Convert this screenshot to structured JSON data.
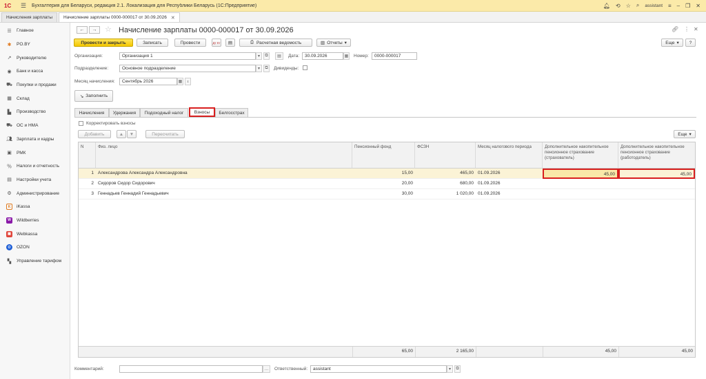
{
  "app": {
    "title": "Бухгалтерия для Беларуси, редакция 2.1. Локализация для Республики Беларусь   (1С:Предприятие)",
    "logo": "1С",
    "user": "assistant",
    "icons": [
      "bell-icon",
      "history-icon",
      "star-icon",
      "search-icon",
      "settings-icon",
      "minimize-icon",
      "restore-icon",
      "close-icon"
    ]
  },
  "tabs": [
    {
      "label": "Начисления зарплаты",
      "closable": false
    },
    {
      "label": "Начисление зарплаты 0000-000017 от 30.09.2026",
      "closable": true
    }
  ],
  "sidebar": {
    "items": [
      {
        "label": "Главное",
        "icon": "menu-icon"
      },
      {
        "label": "PO.BY",
        "icon": "po-icon"
      },
      {
        "label": "Руководителю",
        "icon": "chart-line-icon"
      },
      {
        "label": "Банк и касса",
        "icon": "bank-icon"
      },
      {
        "label": "Покупки и продажи",
        "icon": "cart-icon"
      },
      {
        "label": "Склад",
        "icon": "warehouse-icon"
      },
      {
        "label": "Производство",
        "icon": "factory-icon"
      },
      {
        "label": "ОС и НМА",
        "icon": "truck-icon"
      },
      {
        "label": "Зарплата и кадры",
        "icon": "people-icon"
      },
      {
        "label": "РМК",
        "icon": "cash-register-icon"
      },
      {
        "label": "Налоги и отчетность",
        "icon": "percent-icon"
      },
      {
        "label": "Настройки учета",
        "icon": "settings-doc-icon"
      },
      {
        "label": "Администрирование",
        "icon": "gear-icon"
      },
      {
        "label": "iKassa",
        "icon": "ikassa-icon"
      },
      {
        "label": "Wildberries",
        "icon": "wildberries-icon"
      },
      {
        "label": "Webkassa",
        "icon": "webkassa-icon"
      },
      {
        "label": "OZON",
        "icon": "ozon-icon"
      },
      {
        "label": "Управление тарифом",
        "icon": "tariff-icon"
      }
    ]
  },
  "header": {
    "back": "←",
    "forward": "→",
    "title": "Начисление зарплаты 0000-000017 от 30.09.2026"
  },
  "toolbar": {
    "post_close": "Провести и закрыть",
    "save": "Записать",
    "post": "Провести",
    "dt_kt": "Дт Кт",
    "payslip": "Расчетная ведомость",
    "reports": "Отчеты",
    "more": "Еще"
  },
  "form": {
    "org_label": "Организация:",
    "org_value": "Организация 1",
    "date_label": "Дата:",
    "date_value": "30.09.2026",
    "number_label": "Номер:",
    "number_value": "0000-000017",
    "dept_label": "Подразделение:",
    "dept_value": "Основное подразделение",
    "dividends_label": "Дивиденды:",
    "month_label": "Месяц начисления:",
    "month_value": "Сентябрь 2026",
    "fill_button": "Заполнить"
  },
  "form_tabs": [
    "Начисления",
    "Удержания",
    "Подоходный налог",
    "Взносы",
    "Белгосстрах"
  ],
  "contributions": {
    "correct_label": "Корректировать взносы",
    "add_button": "Добавить",
    "recalc_button": "Пересчитать",
    "more": "Еще",
    "columns": [
      "N",
      "Физ. лицо",
      "Пенсионный фонд",
      "ФСЗН",
      "Месяц налогового периода",
      "Дополнительное накопительное пенсионное страхование (страхователь)",
      "Дополнительное накопительное пенсионное страхование (работодатель)"
    ],
    "rows": [
      {
        "n": "1",
        "person": "Александрова Александра Александровна",
        "pension": "15,00",
        "fszn": "465,00",
        "month": "01.09.2026",
        "ins_insurer": "45,00",
        "ins_employer": "45,00"
      },
      {
        "n": "2",
        "person": "Сидоров Сидор Сидорович",
        "pension": "20,00",
        "fszn": "680,00",
        "month": "01.09.2026",
        "ins_insurer": "",
        "ins_employer": ""
      },
      {
        "n": "3",
        "person": "Геннадьев Геннадий Геннадьевич",
        "pension": "30,00",
        "fszn": "1 020,00",
        "month": "01.09.2026",
        "ins_insurer": "",
        "ins_employer": ""
      }
    ],
    "totals": {
      "pension": "65,00",
      "fszn": "2 165,00",
      "ins_insurer": "45,00",
      "ins_employer": "45,00"
    }
  },
  "footer": {
    "comment_label": "Комментарий:",
    "comment_value": "",
    "responsible_label": "Ответственный:",
    "responsible_value": "assistant"
  },
  "colors": {
    "accent_yellow": "#f5c800",
    "highlight_red": "#d81e1e",
    "titlebar": "#fbeaa9",
    "selected_row": "#fbf3d6"
  }
}
